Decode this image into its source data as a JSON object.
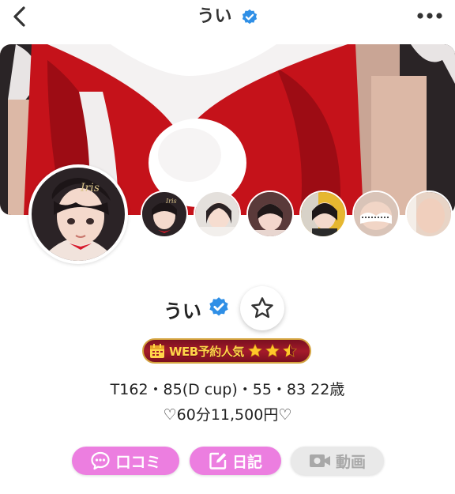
{
  "header": {
    "title": "うい",
    "back_icon": "chevron-left-icon",
    "more_icon": "more-horizontal-icon"
  },
  "cover": {
    "image": "cover-photo"
  },
  "avatar": {
    "image": "profile-photo"
  },
  "thumbnails": [
    {
      "name": "gallery-thumb-1"
    },
    {
      "name": "gallery-thumb-2"
    },
    {
      "name": "gallery-thumb-3"
    },
    {
      "name": "gallery-thumb-4"
    },
    {
      "name": "gallery-thumb-5"
    },
    {
      "name": "gallery-thumb-6"
    }
  ],
  "profile": {
    "name": "うい",
    "verified": true,
    "favorite_icon": "star-outline-icon"
  },
  "badge": {
    "label": "WEB予約人気",
    "rating": 2.5,
    "max_rating": 3
  },
  "specs": {
    "line1": "T162・85(D cup)・55・83  22歳",
    "line2": "♡60分11,500円♡"
  },
  "actions": {
    "review_label": "口コミ",
    "diary_label": "日記",
    "video_label": "動画"
  },
  "colors": {
    "accent_pink": "#ec7ee0",
    "verified_blue": "#2f8fe6",
    "badge_red": "#a41a2a",
    "badge_gold": "#ffd54a",
    "disabled_gray": "#e9e9e9"
  }
}
